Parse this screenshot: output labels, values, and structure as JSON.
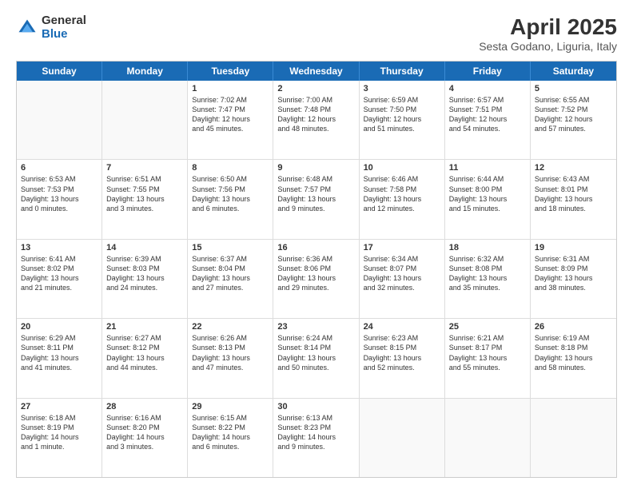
{
  "header": {
    "logo_general": "General",
    "logo_blue": "Blue",
    "title": "April 2025",
    "location": "Sesta Godano, Liguria, Italy"
  },
  "days": [
    "Sunday",
    "Monday",
    "Tuesday",
    "Wednesday",
    "Thursday",
    "Friday",
    "Saturday"
  ],
  "rows": [
    [
      {
        "day": "",
        "content": "",
        "empty": true
      },
      {
        "day": "",
        "content": "",
        "empty": true
      },
      {
        "day": "1",
        "content": "Sunrise: 7:02 AM\nSunset: 7:47 PM\nDaylight: 12 hours\nand 45 minutes."
      },
      {
        "day": "2",
        "content": "Sunrise: 7:00 AM\nSunset: 7:48 PM\nDaylight: 12 hours\nand 48 minutes."
      },
      {
        "day": "3",
        "content": "Sunrise: 6:59 AM\nSunset: 7:50 PM\nDaylight: 12 hours\nand 51 minutes."
      },
      {
        "day": "4",
        "content": "Sunrise: 6:57 AM\nSunset: 7:51 PM\nDaylight: 12 hours\nand 54 minutes."
      },
      {
        "day": "5",
        "content": "Sunrise: 6:55 AM\nSunset: 7:52 PM\nDaylight: 12 hours\nand 57 minutes."
      }
    ],
    [
      {
        "day": "6",
        "content": "Sunrise: 6:53 AM\nSunset: 7:53 PM\nDaylight: 13 hours\nand 0 minutes."
      },
      {
        "day": "7",
        "content": "Sunrise: 6:51 AM\nSunset: 7:55 PM\nDaylight: 13 hours\nand 3 minutes."
      },
      {
        "day": "8",
        "content": "Sunrise: 6:50 AM\nSunset: 7:56 PM\nDaylight: 13 hours\nand 6 minutes."
      },
      {
        "day": "9",
        "content": "Sunrise: 6:48 AM\nSunset: 7:57 PM\nDaylight: 13 hours\nand 9 minutes."
      },
      {
        "day": "10",
        "content": "Sunrise: 6:46 AM\nSunset: 7:58 PM\nDaylight: 13 hours\nand 12 minutes."
      },
      {
        "day": "11",
        "content": "Sunrise: 6:44 AM\nSunset: 8:00 PM\nDaylight: 13 hours\nand 15 minutes."
      },
      {
        "day": "12",
        "content": "Sunrise: 6:43 AM\nSunset: 8:01 PM\nDaylight: 13 hours\nand 18 minutes."
      }
    ],
    [
      {
        "day": "13",
        "content": "Sunrise: 6:41 AM\nSunset: 8:02 PM\nDaylight: 13 hours\nand 21 minutes."
      },
      {
        "day": "14",
        "content": "Sunrise: 6:39 AM\nSunset: 8:03 PM\nDaylight: 13 hours\nand 24 minutes."
      },
      {
        "day": "15",
        "content": "Sunrise: 6:37 AM\nSunset: 8:04 PM\nDaylight: 13 hours\nand 27 minutes."
      },
      {
        "day": "16",
        "content": "Sunrise: 6:36 AM\nSunset: 8:06 PM\nDaylight: 13 hours\nand 29 minutes."
      },
      {
        "day": "17",
        "content": "Sunrise: 6:34 AM\nSunset: 8:07 PM\nDaylight: 13 hours\nand 32 minutes."
      },
      {
        "day": "18",
        "content": "Sunrise: 6:32 AM\nSunset: 8:08 PM\nDaylight: 13 hours\nand 35 minutes."
      },
      {
        "day": "19",
        "content": "Sunrise: 6:31 AM\nSunset: 8:09 PM\nDaylight: 13 hours\nand 38 minutes."
      }
    ],
    [
      {
        "day": "20",
        "content": "Sunrise: 6:29 AM\nSunset: 8:11 PM\nDaylight: 13 hours\nand 41 minutes."
      },
      {
        "day": "21",
        "content": "Sunrise: 6:27 AM\nSunset: 8:12 PM\nDaylight: 13 hours\nand 44 minutes."
      },
      {
        "day": "22",
        "content": "Sunrise: 6:26 AM\nSunset: 8:13 PM\nDaylight: 13 hours\nand 47 minutes."
      },
      {
        "day": "23",
        "content": "Sunrise: 6:24 AM\nSunset: 8:14 PM\nDaylight: 13 hours\nand 50 minutes."
      },
      {
        "day": "24",
        "content": "Sunrise: 6:23 AM\nSunset: 8:15 PM\nDaylight: 13 hours\nand 52 minutes."
      },
      {
        "day": "25",
        "content": "Sunrise: 6:21 AM\nSunset: 8:17 PM\nDaylight: 13 hours\nand 55 minutes."
      },
      {
        "day": "26",
        "content": "Sunrise: 6:19 AM\nSunset: 8:18 PM\nDaylight: 13 hours\nand 58 minutes."
      }
    ],
    [
      {
        "day": "27",
        "content": "Sunrise: 6:18 AM\nSunset: 8:19 PM\nDaylight: 14 hours\nand 1 minute."
      },
      {
        "day": "28",
        "content": "Sunrise: 6:16 AM\nSunset: 8:20 PM\nDaylight: 14 hours\nand 3 minutes."
      },
      {
        "day": "29",
        "content": "Sunrise: 6:15 AM\nSunset: 8:22 PM\nDaylight: 14 hours\nand 6 minutes."
      },
      {
        "day": "30",
        "content": "Sunrise: 6:13 AM\nSunset: 8:23 PM\nDaylight: 14 hours\nand 9 minutes."
      },
      {
        "day": "",
        "content": "",
        "empty": true
      },
      {
        "day": "",
        "content": "",
        "empty": true
      },
      {
        "day": "",
        "content": "",
        "empty": true
      }
    ]
  ]
}
